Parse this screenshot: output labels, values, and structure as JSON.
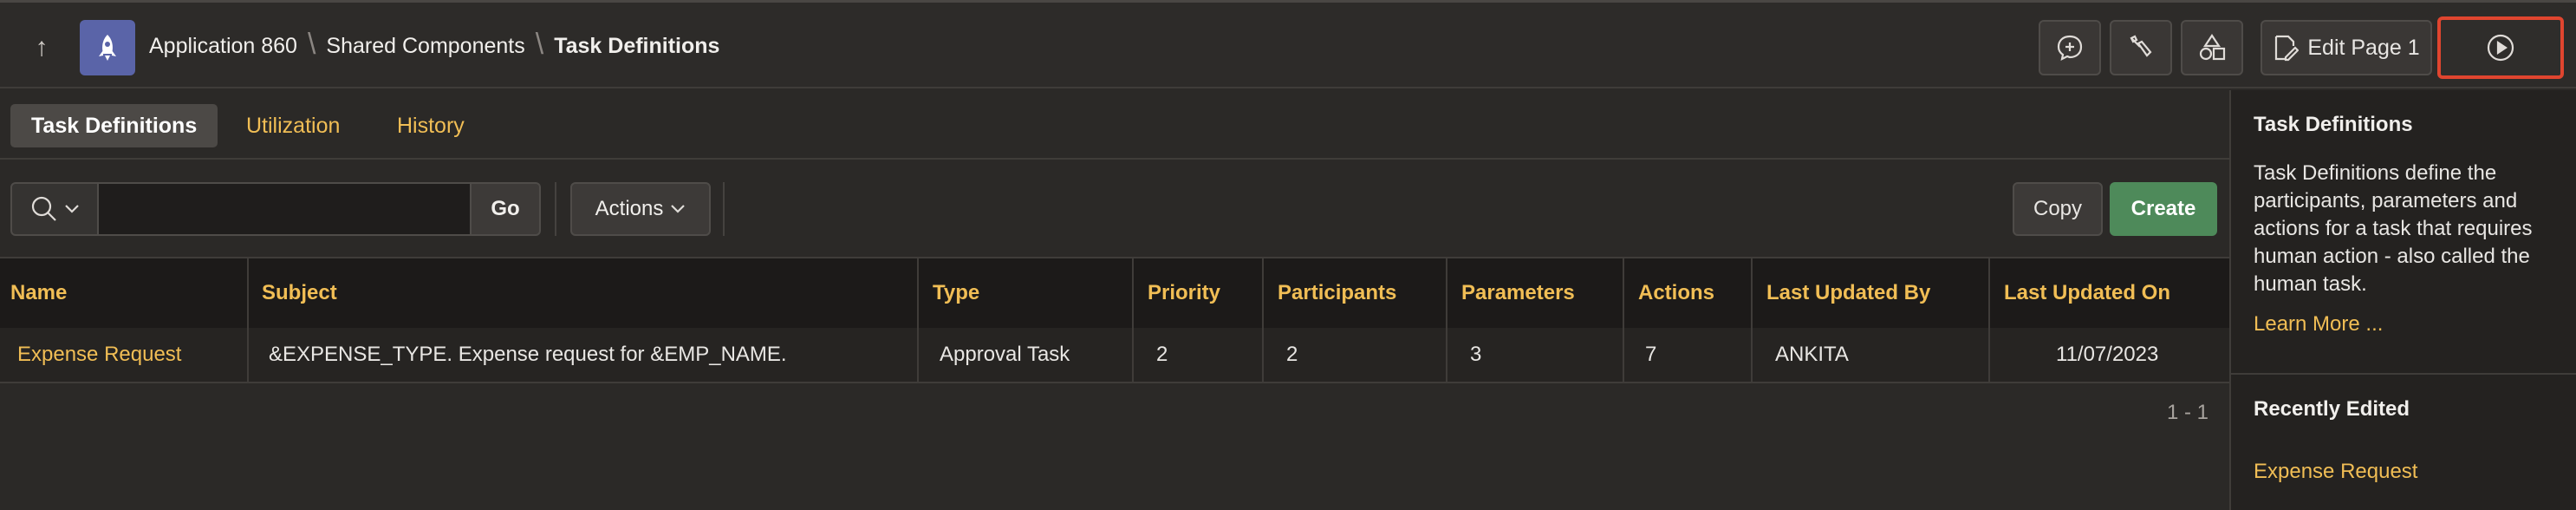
{
  "header": {
    "breadcrumb": [
      "Application 860",
      "Shared Components",
      "Task Definitions"
    ],
    "edit_page_label": "Edit Page 1"
  },
  "tabs": [
    {
      "label": "Task Definitions",
      "active": true
    },
    {
      "label": "Utilization",
      "active": false
    },
    {
      "label": "History",
      "active": false
    }
  ],
  "toolbar": {
    "search_value": "",
    "go_label": "Go",
    "actions_label": "Actions",
    "copy_label": "Copy",
    "create_label": "Create"
  },
  "table": {
    "columns": [
      "Name",
      "Subject",
      "Type",
      "Priority",
      "Participants",
      "Parameters",
      "Actions",
      "Last Updated By",
      "Last Updated On"
    ],
    "rows": [
      [
        "Expense Request",
        "&EXPENSE_TYPE. Expense request for &EMP_NAME.",
        "Approval Task",
        "2",
        "2",
        "3",
        "7",
        "ANKITA",
        "11/07/2023"
      ]
    ],
    "pagination": "1 - 1"
  },
  "side_panel": {
    "title": "Task Definitions",
    "description": "Task Definitions define the participants, parameters and actions for a task that requires human action - also called the human task.",
    "learn_more": "Learn More ...",
    "recent_title": "Recently Edited",
    "recent_items": [
      "Expense Request"
    ]
  },
  "colors": {
    "accent": "#f1be55",
    "create_button": "#4e8a5a",
    "run_highlight": "#e0452f",
    "app_icon": "#5a64a8"
  }
}
